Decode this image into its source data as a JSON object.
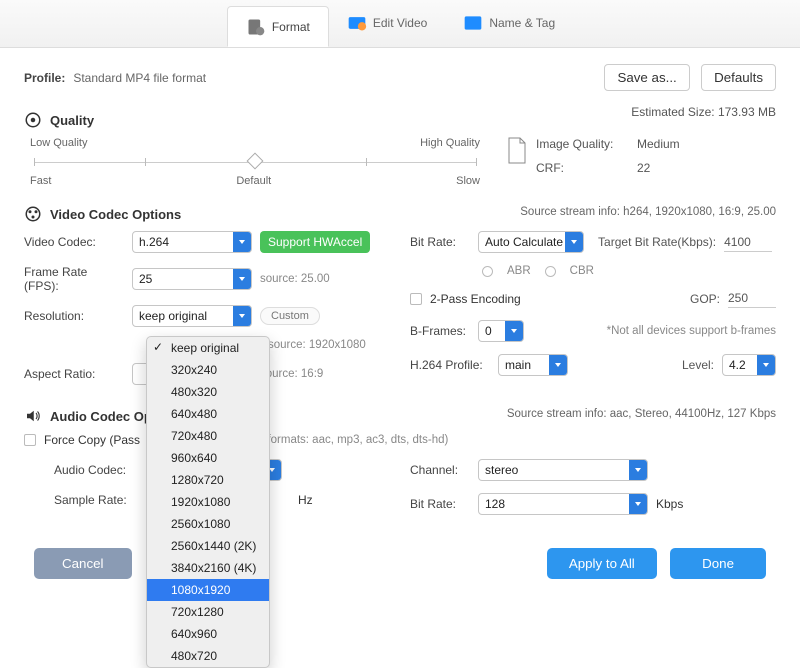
{
  "tabs": {
    "format": "Format",
    "edit": "Edit Video",
    "nametag": "Name & Tag"
  },
  "profile": {
    "label": "Profile:",
    "value": "Standard MP4 file format",
    "save_as": "Save as...",
    "defaults": "Defaults"
  },
  "quality": {
    "heading": "Quality",
    "low": "Low Quality",
    "high": "High Quality",
    "fast": "Fast",
    "default": "Default",
    "slow": "Slow",
    "estimated_label": "Estimated Size:",
    "estimated_value": "173.93 MB",
    "image_quality_label": "Image Quality:",
    "image_quality_value": "Medium",
    "crf_label": "CRF:",
    "crf_value": "22"
  },
  "video": {
    "heading": "Video Codec Options",
    "source_info": "Source stream info: h264, 1920x1080, 16:9, 25.00",
    "codec_label": "Video Codec:",
    "codec_value": "h.264",
    "hwaccel": "Support HWAccel",
    "fps_label": "Frame Rate (FPS):",
    "fps_value": "25",
    "fps_src": "source: 25.00",
    "res_label": "Resolution:",
    "res_value": "keep original",
    "res_custom": "Custom",
    "res_src": "source: 1920x1080",
    "ar_label": "Aspect Ratio:",
    "ar_src": "source: 16:9",
    "bitrate_label": "Bit Rate:",
    "bitrate_value": "Auto Calculate",
    "target_bitrate_label": "Target Bit Rate(Kbps):",
    "target_bitrate_value": "4100",
    "abr": "ABR",
    "cbr": "CBR",
    "twopass": "2-Pass Encoding",
    "gop_label": "GOP:",
    "gop_value": "250",
    "bframes_label": "B-Frames:",
    "bframes_value": "0",
    "bframes_note": "*Not all devices support b-frames",
    "profile_label": "H.264 Profile:",
    "profile_value": "main",
    "level_label": "Level:",
    "level_value": "4.2"
  },
  "audio": {
    "heading": "Audio Codec Options",
    "source_info": "Source stream info: aac, Stereo, 44100Hz, 127 Kbps",
    "force_copy": "Force Copy (Pass",
    "supports": "orted formats: aac, mp3, ac3, dts, dts-hd)",
    "codec_label": "Audio Codec:",
    "channel_label": "Channel:",
    "channel_value": "stereo",
    "sample_label": "Sample Rate:",
    "sample_unit": "Hz",
    "bitrate_label": "Bit Rate:",
    "bitrate_value": "128",
    "bitrate_unit": "Kbps"
  },
  "buttons": {
    "cancel": "Cancel",
    "apply_all": "Apply to All",
    "done": "Done"
  },
  "resolution_options": [
    {
      "label": "keep original",
      "checked": true,
      "selected": false
    },
    {
      "label": "320x240"
    },
    {
      "label": "480x320"
    },
    {
      "label": "640x480"
    },
    {
      "label": "720x480"
    },
    {
      "label": "960x640"
    },
    {
      "label": "1280x720"
    },
    {
      "label": "1920x1080"
    },
    {
      "label": "2560x1080"
    },
    {
      "label": "2560x1440 (2K)"
    },
    {
      "label": "3840x2160 (4K)"
    },
    {
      "label": "1080x1920",
      "selected": true
    },
    {
      "label": "720x1280"
    },
    {
      "label": "640x960"
    },
    {
      "label": "480x720"
    }
  ]
}
